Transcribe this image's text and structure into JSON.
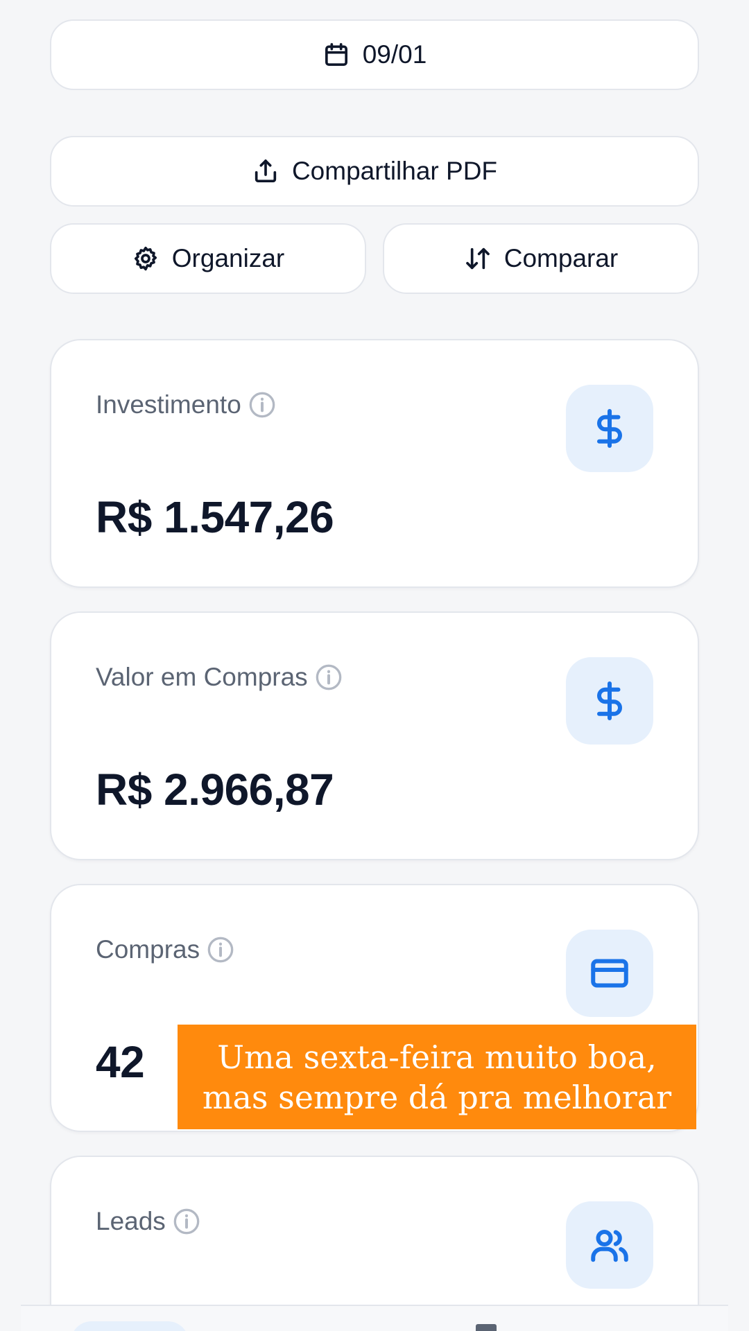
{
  "toolbar": {
    "date_label": "09/01",
    "share_label": "Compartilhar PDF",
    "organize_label": "Organizar",
    "compare_label": "Comparar"
  },
  "cards": {
    "investimento": {
      "label": "Investimento",
      "value": "R$ 1.547,26",
      "icon": "dollar-icon"
    },
    "valor_compras": {
      "label": "Valor em Compras",
      "value": "R$ 2.966,87",
      "icon": "dollar-icon"
    },
    "compras": {
      "label": "Compras",
      "value": "42",
      "icon": "credit-card-icon"
    },
    "leads": {
      "label": "Leads",
      "icon": "users-icon"
    }
  },
  "banner": {
    "text": "Uma sexta-feira muito boa, mas sempre dá pra melhorar"
  },
  "colors": {
    "accent": "#1a73e8",
    "icon_bg": "#e6f0fc",
    "banner_bg": "#ff8a0d",
    "page_bg": "#f5f6f8"
  }
}
